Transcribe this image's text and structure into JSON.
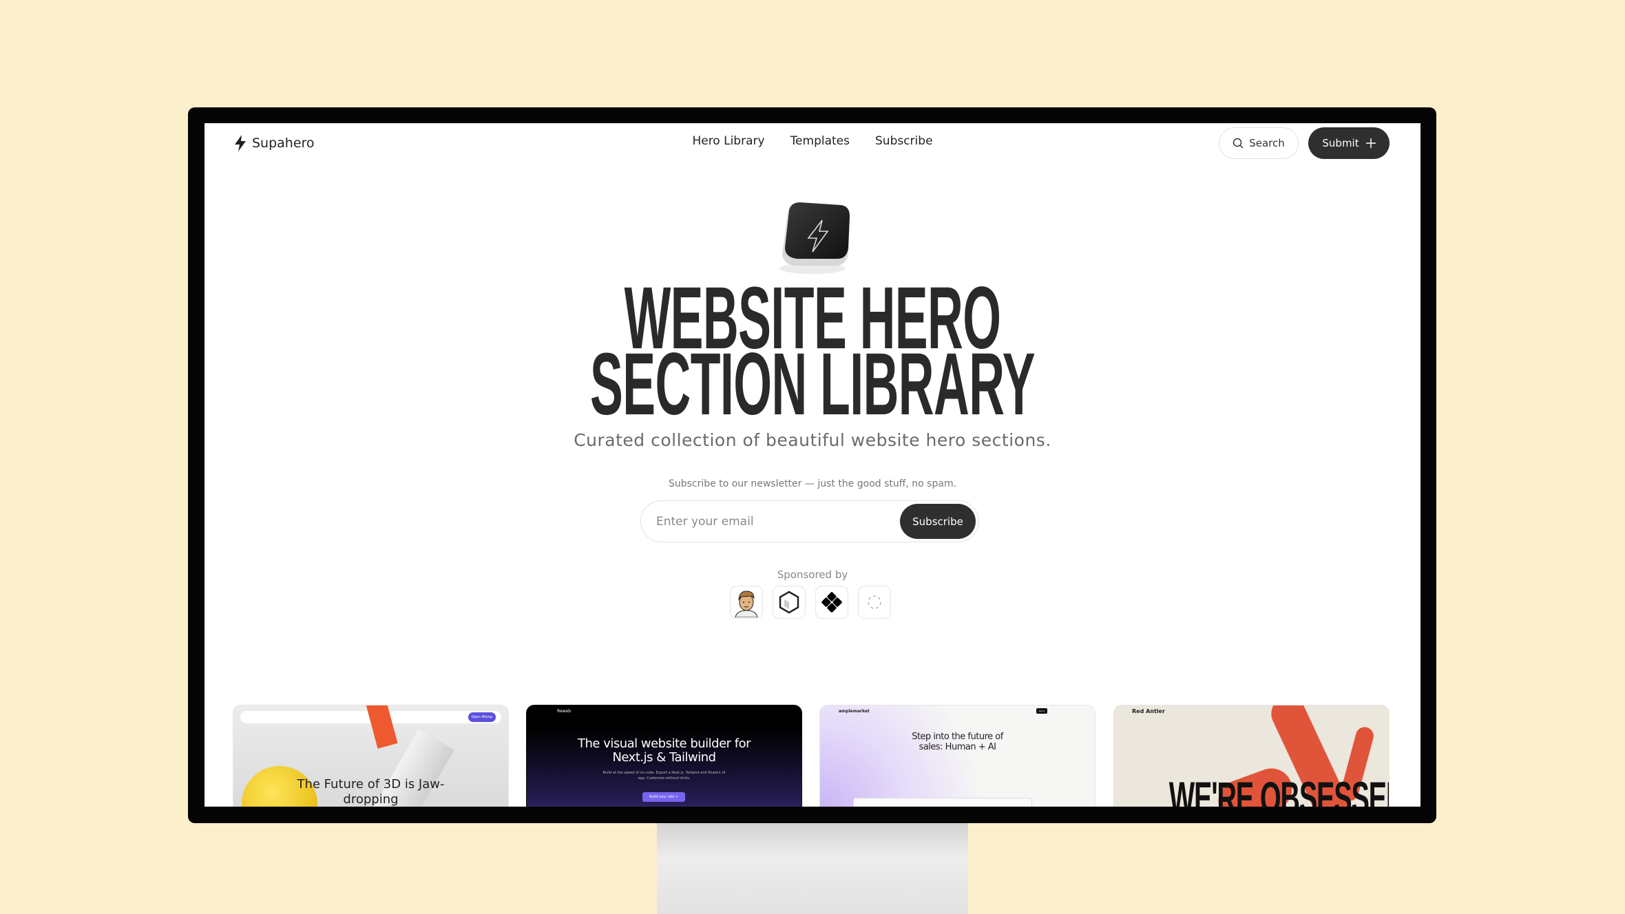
{
  "brand": {
    "name": "Supahero"
  },
  "nav": {
    "items": [
      {
        "label": "Hero Library"
      },
      {
        "label": "Templates"
      },
      {
        "label": "Subscribe"
      }
    ]
  },
  "header": {
    "search_label": "Search",
    "submit_label": "Submit"
  },
  "hero": {
    "title_line1": "WEBSITE HERO",
    "title_line2": "SECTION LIBRARY",
    "subtitle": "Curated collection of beautiful website hero sections."
  },
  "newsletter": {
    "text": "Subscribe to our newsletter — just the good stuff, no spam.",
    "placeholder": "Enter your email",
    "button": "Subscribe"
  },
  "sponsors": {
    "label": "Sponsored by",
    "icons": [
      "avatar-face",
      "hexagon",
      "diamond-grid",
      "dashed-circle"
    ]
  },
  "cards": [
    {
      "title": "The Future of 3D is Jaw-dropping",
      "brand": "Womp",
      "cta": "Open Womp"
    },
    {
      "title": "The visual website builder for Next.js & Tailwind",
      "brand": "Reweb",
      "body": "Build at the speed of no-code. Export a Next.js, Tailwind and Shadcn UI app. Customize without limits.",
      "cta": "Build your site >"
    },
    {
      "title": "Step into the future of sales: Human + AI",
      "brand": "amplemarket",
      "cta": "Get a demo"
    },
    {
      "title": "WE'RE OBSESSED",
      "brand": "Red Antler"
    }
  ],
  "colors": {
    "background": "#fcefcb",
    "button_dark": "#2f2f2f",
    "accent_purple": "#6b5cf0",
    "red_antler": "#e0553a"
  }
}
